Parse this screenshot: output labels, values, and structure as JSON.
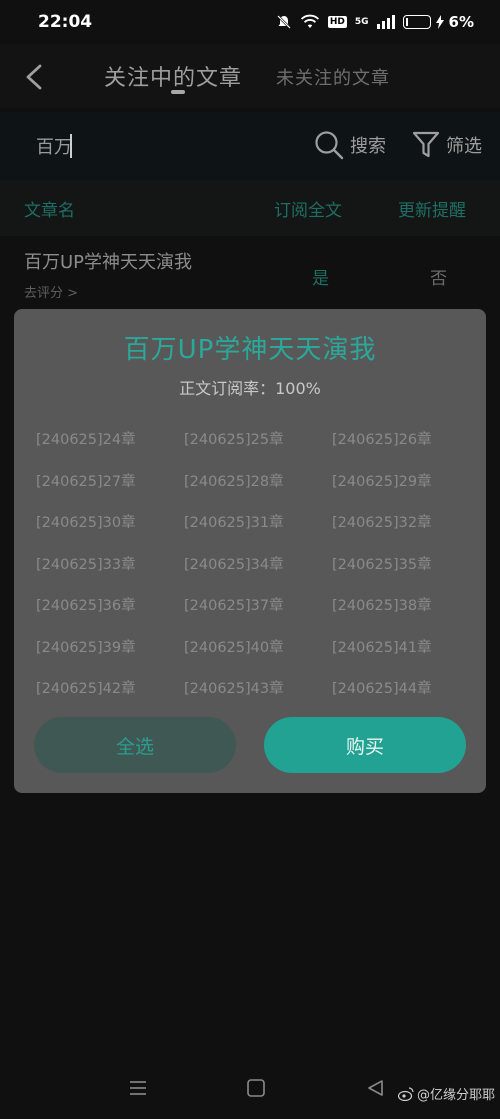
{
  "status_bar": {
    "time": "22:04",
    "hd": "HD",
    "network": "5G",
    "battery": "6%"
  },
  "header": {
    "tab_following": "关注中的文章",
    "tab_unfollowed": "未关注的文章"
  },
  "search": {
    "value": "百万",
    "button_label": "搜索",
    "filter_label": "筛选"
  },
  "columns": {
    "name": "文章名",
    "subscribe_full": "订阅全文",
    "update_remind": "更新提醒"
  },
  "list_row": {
    "title": "百万UP学神天天演我",
    "rate_link": "去评分 >",
    "subscribed": "是",
    "remind": "否"
  },
  "modal": {
    "title": "百万UP学神天天演我",
    "subscription_rate": "正文订阅率：100%",
    "chapters": [
      "[240625]24章",
      "[240625]25章",
      "[240625]26章",
      "[240625]27章",
      "[240625]28章",
      "[240625]29章",
      "[240625]30章",
      "[240625]31章",
      "[240625]32章",
      "[240625]33章",
      "[240625]34章",
      "[240625]35章",
      "[240625]36章",
      "[240625]37章",
      "[240625]38章",
      "[240625]39章",
      "[240625]40章",
      "[240625]41章",
      "[240625]42章",
      "[240625]43章",
      "[240625]44章"
    ],
    "select_all": "全选",
    "buy": "购买"
  },
  "watermark": "@亿缘分耶耶",
  "colors": {
    "accent": "#22a293",
    "modal_bg": "#585858",
    "page_bg": "#101010"
  }
}
